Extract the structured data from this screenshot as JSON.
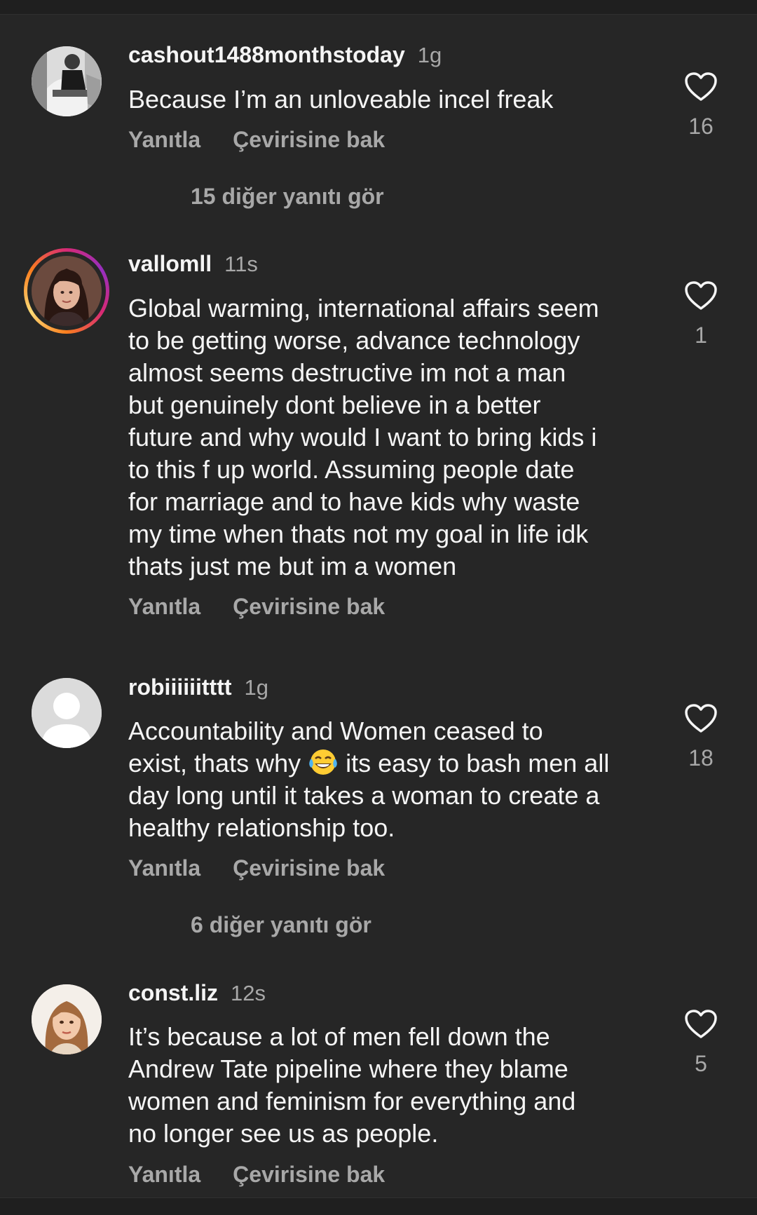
{
  "comments": [
    {
      "username": "cashout1488monthstoday",
      "time": "1g",
      "text": "Because I’m an unloveable incel freak",
      "reply": "Yanıtla",
      "translate": "Çevirisine bak",
      "likes": "16",
      "more_replies": "15 diğer yanıtı gör",
      "has_story_ring": false,
      "avatar": "bw-photo-avatar"
    },
    {
      "username": "vallomll",
      "time": "11s",
      "text_lines": [
        "Global warming, international affairs seem",
        "to be getting worse, advance technology",
        "almost seems destructive im not a man",
        "but genuinely dont believe in a better",
        "future and why would I want to bring kids i",
        "to this f up world. Assuming people date",
        "for marriage and to have kids why waste",
        "my time when thats not my goal in life idk",
        "thats just me but im a women"
      ],
      "reply": "Yanıtla",
      "translate": "Çevirisine bak",
      "likes": "1",
      "has_story_ring": true,
      "avatar": "woman-portrait-avatar"
    },
    {
      "username": "robiiiiiitttt",
      "time": "1g",
      "text_lines": [
        "Accountability and Women ceased to",
        "exist, thats why",
        "its easy to bash men all",
        "day long until it takes a woman to create a",
        "healthy relationship too."
      ],
      "emoji": "face-with-tears-of-joy",
      "reply": "Yanıtla",
      "translate": "Çevirisine bak",
      "likes": "18",
      "more_replies": "6 diğer yanıtı gör",
      "has_story_ring": false,
      "avatar": "default-user-avatar"
    },
    {
      "username": "const.liz",
      "time": "12s",
      "text_lines": [
        "It’s because a lot of men fell down the",
        "Andrew Tate pipeline where they blame",
        "women and feminism for everything and",
        "no longer see us as people."
      ],
      "reply": "Yanıtla",
      "translate": "Çevirisine bak",
      "likes": "5",
      "has_story_ring": false,
      "avatar": "illustrated-woman-avatar"
    }
  ],
  "colors": {
    "background": "#262626",
    "primary_text": "#f5f5f5",
    "secondary_text": "#a8a8a8"
  },
  "icons": {
    "like": "heart-outline-icon"
  }
}
